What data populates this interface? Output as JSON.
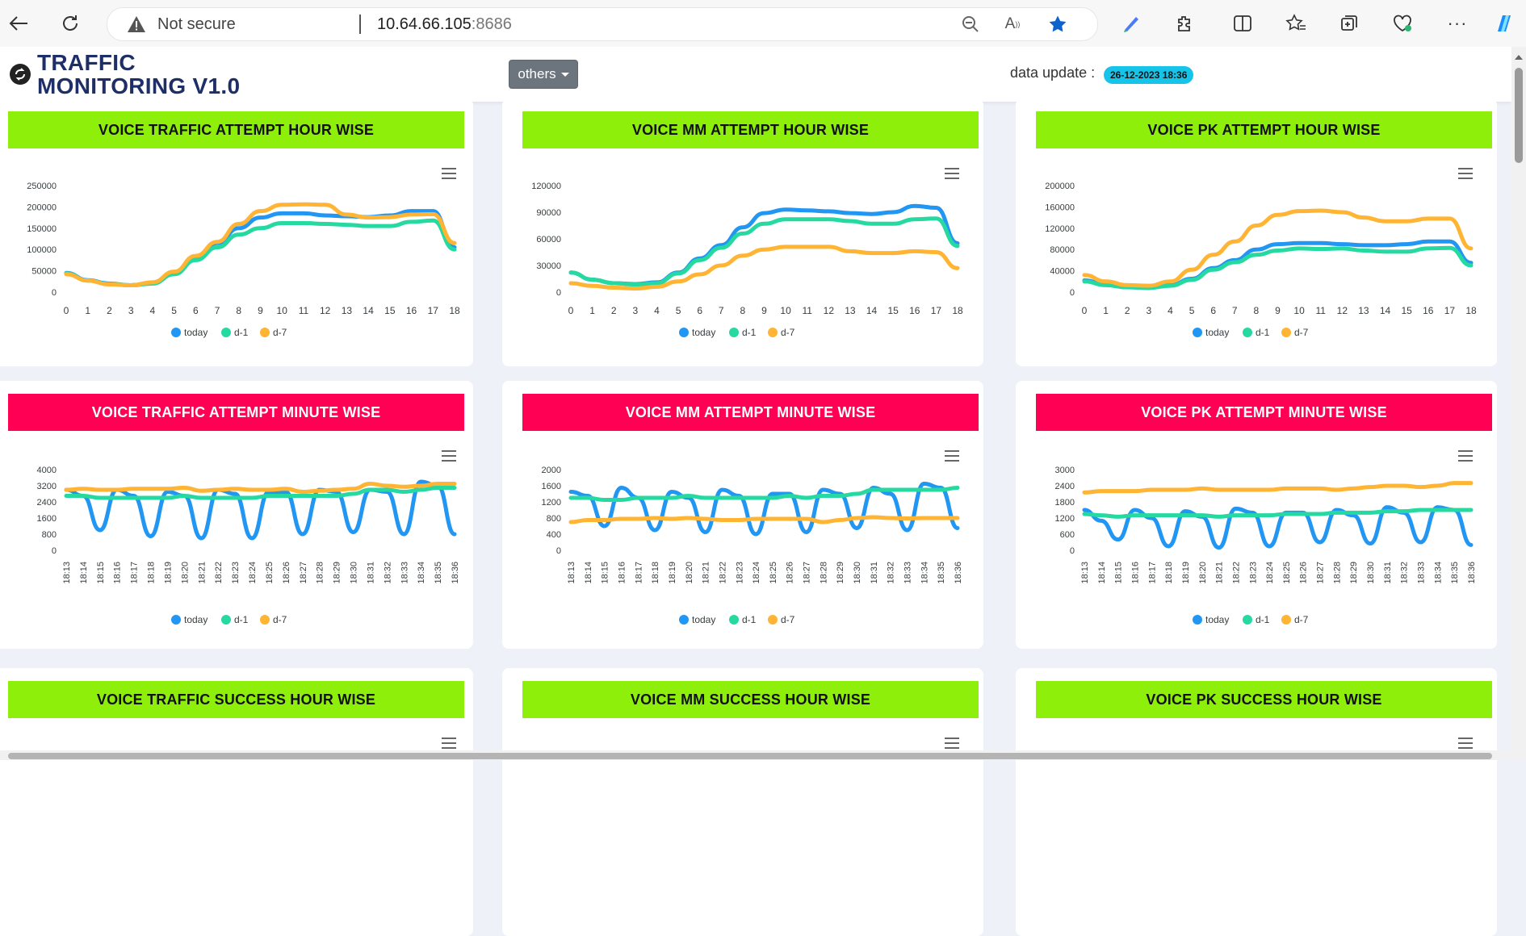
{
  "browser": {
    "not_secure": "Not secure",
    "url_host": "10.64.66.105",
    "url_port": ":8686"
  },
  "header": {
    "logo_line1": "TRAFFIC",
    "logo_line2": "MONITORING V1.0",
    "dropdown_label": "others",
    "data_update_label": "data update :",
    "data_update_value": "26-12-2023 18:36"
  },
  "colors": {
    "today": "#2196f3",
    "d1": "#26d9a0",
    "d7": "#ffb433",
    "title_green": "#8ef00a",
    "title_red": "#ff0055"
  },
  "legend": [
    "today",
    "d-1",
    "d-7"
  ],
  "cards": [
    {
      "title": "VOICE TRAFFIC ATTEMPT HOUR WISE",
      "style": "green",
      "chart": 0
    },
    {
      "title": "VOICE MM ATTEMPT HOUR WISE",
      "style": "green",
      "chart": 1
    },
    {
      "title": "VOICE PK ATTEMPT HOUR WISE",
      "style": "green",
      "chart": 2
    },
    {
      "title": "VOICE TRAFFIC ATTEMPT MINUTE WISE",
      "style": "red",
      "chart": 3
    },
    {
      "title": "VOICE MM ATTEMPT MINUTE WISE",
      "style": "red",
      "chart": 4
    },
    {
      "title": "VOICE PK ATTEMPT MINUTE WISE",
      "style": "red",
      "chart": 5
    },
    {
      "title": "VOICE TRAFFIC SUCCESS HOUR WISE",
      "style": "green",
      "chart": null
    },
    {
      "title": "VOICE MM SUCCESS HOUR WISE",
      "style": "green",
      "chart": null
    },
    {
      "title": "VOICE PK SUCCESS HOUR WISE",
      "style": "green",
      "chart": null
    }
  ],
  "chart_data": [
    {
      "type": "line",
      "title": "VOICE TRAFFIC ATTEMPT HOUR WISE",
      "x": [
        0,
        1,
        2,
        3,
        4,
        5,
        6,
        7,
        8,
        9,
        10,
        11,
        12,
        13,
        14,
        15,
        16,
        17,
        18
      ],
      "yticks": [
        0,
        50000,
        100000,
        150000,
        200000,
        250000
      ],
      "ylim": [
        0,
        250000
      ],
      "series": [
        {
          "name": "today",
          "values": [
            45000,
            28000,
            20000,
            16000,
            22000,
            45000,
            80000,
            115000,
            150000,
            175000,
            185000,
            185000,
            180000,
            178000,
            176000,
            180000,
            190000,
            190000,
            105000
          ]
        },
        {
          "name": "d-1",
          "values": [
            44000,
            27000,
            19000,
            16000,
            20000,
            42000,
            75000,
            105000,
            135000,
            150000,
            162000,
            162000,
            160000,
            158000,
            155000,
            155000,
            165000,
            168000,
            100000
          ]
        },
        {
          "name": "d-7",
          "values": [
            42000,
            27000,
            18000,
            16000,
            23000,
            48000,
            85000,
            118000,
            160000,
            190000,
            205000,
            206000,
            205000,
            182000,
            175000,
            176000,
            182000,
            183000,
            115000
          ]
        }
      ]
    },
    {
      "type": "line",
      "title": "VOICE MM ATTEMPT HOUR WISE",
      "x": [
        0,
        1,
        2,
        3,
        4,
        5,
        6,
        7,
        8,
        9,
        10,
        11,
        12,
        13,
        14,
        15,
        16,
        17,
        18
      ],
      "yticks": [
        0,
        30000,
        60000,
        90000,
        120000
      ],
      "ylim": [
        0,
        120000
      ],
      "series": [
        {
          "name": "today",
          "values": [
            22000,
            14000,
            10000,
            9000,
            11000,
            22000,
            38000,
            53000,
            73000,
            89000,
            93000,
            92000,
            91000,
            89000,
            88000,
            90000,
            97000,
            95000,
            55000
          ]
        },
        {
          "name": "d-1",
          "values": [
            22000,
            14000,
            10000,
            8500,
            10000,
            21000,
            36000,
            50000,
            66000,
            77000,
            82000,
            82000,
            82000,
            80000,
            77000,
            77000,
            82000,
            83000,
            52000
          ]
        },
        {
          "name": "d-7",
          "values": [
            10000,
            7000,
            5000,
            4000,
            6000,
            12000,
            20000,
            30000,
            41000,
            48000,
            51000,
            51000,
            51000,
            46000,
            44000,
            44000,
            46000,
            45000,
            27000
          ]
        }
      ]
    },
    {
      "type": "line",
      "title": "VOICE PK ATTEMPT HOUR WISE",
      "x": [
        0,
        1,
        2,
        3,
        4,
        5,
        6,
        7,
        8,
        9,
        10,
        11,
        12,
        13,
        14,
        15,
        16,
        17,
        18
      ],
      "yticks": [
        0,
        40000,
        80000,
        120000,
        160000,
        200000
      ],
      "ylim": [
        0,
        200000
      ],
      "series": [
        {
          "name": "today",
          "values": [
            22000,
            14000,
            9000,
            8000,
            13000,
            25000,
            45000,
            60000,
            80000,
            90000,
            92000,
            92000,
            90000,
            88000,
            88000,
            90000,
            95000,
            95000,
            55000
          ]
        },
        {
          "name": "d-1",
          "values": [
            20000,
            13000,
            9000,
            8000,
            12000,
            23000,
            42000,
            56000,
            70000,
            78000,
            82000,
            81000,
            82000,
            78000,
            76000,
            76000,
            82000,
            83000,
            50000
          ]
        },
        {
          "name": "d-7",
          "values": [
            32000,
            20000,
            13000,
            12000,
            20000,
            42000,
            70000,
            95000,
            125000,
            145000,
            152000,
            153000,
            150000,
            140000,
            133000,
            133000,
            138000,
            138000,
            82000
          ]
        }
      ]
    },
    {
      "type": "line",
      "title": "VOICE TRAFFIC ATTEMPT MINUTE WISE",
      "x": [
        "18:13",
        "18:14",
        "18:15",
        "18:16",
        "18:17",
        "18:18",
        "18:19",
        "18:20",
        "18:21",
        "18:22",
        "18:23",
        "18:24",
        "18:25",
        "18:26",
        "18:27",
        "18:28",
        "18:29",
        "18:30",
        "18:31",
        "18:32",
        "18:33",
        "18:34",
        "18:35",
        "18:36"
      ],
      "yticks": [
        0,
        800,
        1600,
        2400,
        3200,
        4000
      ],
      "ylim": [
        0,
        4000
      ],
      "series": [
        {
          "name": "today",
          "values": [
            3000,
            2700,
            1000,
            3000,
            2700,
            700,
            2900,
            2700,
            600,
            3000,
            2800,
            600,
            2900,
            2900,
            800,
            3000,
            2900,
            900,
            3000,
            2900,
            800,
            3400,
            3200,
            800
          ]
        },
        {
          "name": "d-1",
          "values": [
            2700,
            2700,
            2600,
            2600,
            2600,
            2600,
            2600,
            2700,
            2600,
            2600,
            2600,
            2600,
            2700,
            2700,
            2700,
            2700,
            2700,
            2800,
            3000,
            3000,
            2900,
            3000,
            3100,
            3100
          ]
        },
        {
          "name": "d-7",
          "values": [
            3000,
            3050,
            3000,
            3000,
            3050,
            3050,
            3050,
            3100,
            2950,
            3000,
            3050,
            3000,
            3000,
            3050,
            2900,
            2950,
            3000,
            3050,
            3300,
            3200,
            3150,
            3200,
            3300,
            3300
          ]
        }
      ]
    },
    {
      "type": "line",
      "title": "VOICE MM ATTEMPT MINUTE WISE",
      "x": [
        "18:13",
        "18:14",
        "18:15",
        "18:16",
        "18:17",
        "18:18",
        "18:19",
        "18:20",
        "18:21",
        "18:22",
        "18:23",
        "18:24",
        "18:25",
        "18:26",
        "18:27",
        "18:28",
        "18:29",
        "18:30",
        "18:31",
        "18:32",
        "18:33",
        "18:34",
        "18:35",
        "18:36"
      ],
      "yticks": [
        0,
        400,
        800,
        1200,
        1600,
        2000
      ],
      "ylim": [
        0,
        2000
      ],
      "series": [
        {
          "name": "today",
          "values": [
            1450,
            1350,
            600,
            1550,
            1300,
            500,
            1450,
            1300,
            450,
            1500,
            1350,
            400,
            1400,
            1400,
            450,
            1500,
            1400,
            550,
            1550,
            1400,
            500,
            1650,
            1550,
            550
          ]
        },
        {
          "name": "d-1",
          "values": [
            1300,
            1300,
            1250,
            1250,
            1300,
            1300,
            1300,
            1350,
            1300,
            1300,
            1300,
            1300,
            1300,
            1350,
            1300,
            1350,
            1350,
            1400,
            1500,
            1500,
            1500,
            1500,
            1500,
            1550
          ]
        },
        {
          "name": "d-7",
          "values": [
            700,
            750,
            750,
            780,
            780,
            800,
            780,
            800,
            780,
            750,
            750,
            780,
            780,
            780,
            780,
            700,
            750,
            800,
            820,
            800,
            790,
            800,
            800,
            800
          ]
        }
      ]
    },
    {
      "type": "line",
      "title": "VOICE PK ATTEMPT MINUTE WISE",
      "x": [
        "18:13",
        "18:14",
        "18:15",
        "18:16",
        "18:17",
        "18:18",
        "18:19",
        "18:20",
        "18:21",
        "18:22",
        "18:23",
        "18:24",
        "18:25",
        "18:26",
        "18:27",
        "18:28",
        "18:29",
        "18:30",
        "18:31",
        "18:32",
        "18:33",
        "18:34",
        "18:35",
        "18:36"
      ],
      "yticks": [
        0,
        600,
        1200,
        1800,
        2400,
        3000
      ],
      "ylim": [
        0,
        3000
      ],
      "series": [
        {
          "name": "today",
          "values": [
            1500,
            1100,
            400,
            1500,
            1200,
            150,
            1450,
            1250,
            100,
            1550,
            1400,
            150,
            1400,
            1400,
            300,
            1500,
            1300,
            250,
            1600,
            1400,
            300,
            1600,
            1500,
            200
          ]
        },
        {
          "name": "d-1",
          "values": [
            1350,
            1300,
            1250,
            1300,
            1300,
            1300,
            1300,
            1300,
            1250,
            1300,
            1300,
            1300,
            1350,
            1350,
            1350,
            1400,
            1400,
            1400,
            1450,
            1450,
            1500,
            1500,
            1500,
            1500
          ]
        },
        {
          "name": "d-7",
          "values": [
            2150,
            2200,
            2200,
            2200,
            2250,
            2250,
            2250,
            2300,
            2250,
            2250,
            2250,
            2250,
            2300,
            2300,
            2300,
            2250,
            2300,
            2350,
            2400,
            2400,
            2350,
            2400,
            2500,
            2500
          ]
        }
      ]
    }
  ]
}
